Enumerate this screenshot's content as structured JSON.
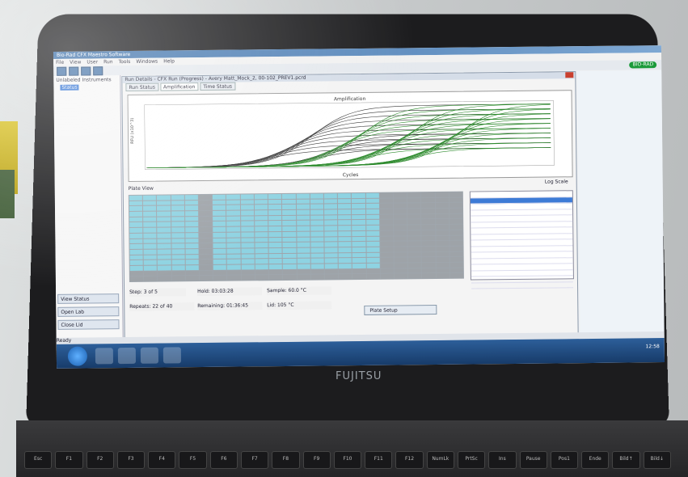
{
  "laptop": {
    "brand": "FUJITSU",
    "window_title": "Bio-Rad CFX Maestro Software",
    "menu": [
      "File",
      "View",
      "User",
      "Run",
      "Tools",
      "Windows",
      "Help"
    ],
    "biorad_logo": "BIO-RAD",
    "tree": {
      "root": "Unlabeled Instruments",
      "item": "Status"
    },
    "run_title": "Run Details - CFX Run (Progress) - Avery Matt_Mock_2, 00-102_PREV1.pcrd",
    "tabs": [
      "Run Status",
      "Amplification",
      "Time Status"
    ],
    "plot_title": "Amplification",
    "xlabel": "Cycles",
    "ylabel": "RFU (x10^3)",
    "log_scale_label": "Log Scale",
    "plate_label": "Plate View",
    "left_buttons": [
      "View Status",
      "Open Lab",
      "Close Lid"
    ],
    "info": {
      "step": "Step: 3 of 5",
      "hold": "Hold: 03:03:28",
      "sample": "Sample: 60.0 °C",
      "repeats": "Repeats: 22 of 40",
      "remaining": "Remaining: 01:36:45",
      "lid": "Lid: 105 °C"
    },
    "setup_button": "Plate Setup",
    "statusbar": "Ready",
    "clock": "12:58"
  },
  "colors": {
    "curves_green": "#2e8b2e",
    "curves_dark": "#333333",
    "well_active": "#8ed3e2"
  },
  "icons": [
    "windows-start-icon",
    "ie-icon",
    "folder-icon",
    "media-icon",
    "cfx-icon"
  ],
  "keys": [
    "Esc",
    "F1",
    "F2",
    "F3",
    "F4",
    "F5",
    "F6",
    "F7",
    "F8",
    "F9",
    "F10",
    "F11",
    "F12",
    "NumLk",
    "PrtSc",
    "Ins",
    "Pause",
    "Pos1",
    "Ende",
    "Bild↑",
    "Bild↓"
  ]
}
